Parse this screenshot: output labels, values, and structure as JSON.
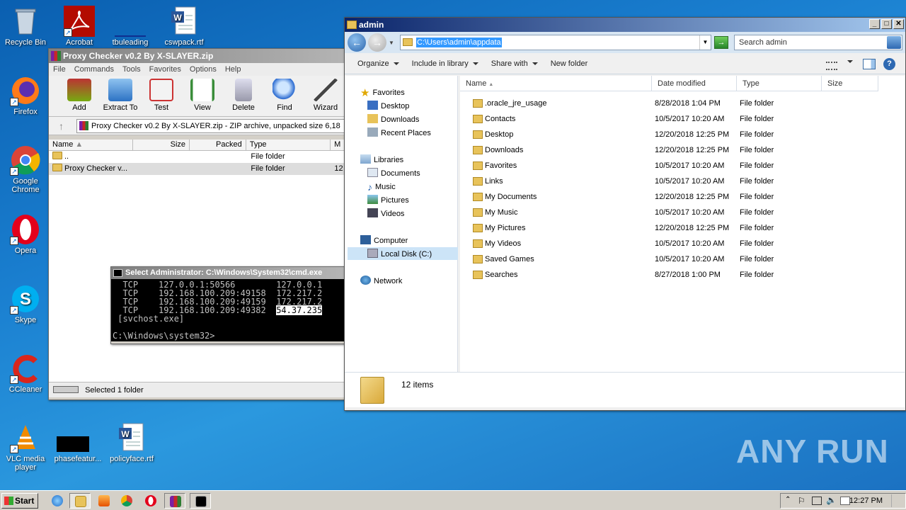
{
  "desktop": {
    "icons": [
      {
        "label": "Recycle Bin"
      },
      {
        "label": "Firefox"
      },
      {
        "label": "Google Chrome"
      },
      {
        "label": "Opera"
      },
      {
        "label": "Skype"
      },
      {
        "label": "CCleaner"
      },
      {
        "label": "VLC media player"
      },
      {
        "label": "Acrobat"
      },
      {
        "label": "tbuleading"
      },
      {
        "label": "cswpack.rtf"
      },
      {
        "label": "phasefeatur..."
      },
      {
        "label": "policyface.rtf"
      }
    ],
    "watermark": "ANY RUN"
  },
  "winrar": {
    "title": "Proxy Checker v0.2 By X-SLAYER.zip",
    "menu": [
      "File",
      "Commands",
      "Tools",
      "Favorites",
      "Options",
      "Help"
    ],
    "tools": [
      "Add",
      "Extract To",
      "Test",
      "View",
      "Delete",
      "Find",
      "Wizard"
    ],
    "path": "Proxy Checker v0.2 By X-SLAYER.zip - ZIP archive, unpacked size 6,18",
    "columns": [
      "Name",
      "Size",
      "Packed",
      "Type",
      "M"
    ],
    "rows": [
      {
        "name": "..",
        "type": "File folder",
        "m": ""
      },
      {
        "name": "Proxy Checker v...",
        "type": "File folder",
        "m": "12"
      }
    ],
    "status": "Selected 1 folder"
  },
  "cmd": {
    "title": "Select Administrator: C:\\Windows\\System32\\cmd.exe",
    "lines": [
      "  TCP    127.0.0.1:50566        127.0.0.1",
      "  TCP    192.168.100.209:49158  172.217.2",
      "  TCP    192.168.100.209:49159  172.217.2",
      "  TCP    192.168.100.209:49382  ",
      " [svchost.exe]",
      "",
      "C:\\Windows\\system32>"
    ],
    "highlight": "54.37.235"
  },
  "explorer": {
    "title": "admin",
    "address": "C:\\Users\\admin\\appdata",
    "search_placeholder": "Search admin",
    "commands": [
      "Organize",
      "Include in library",
      "Share with",
      "New folder"
    ],
    "nav": {
      "favorites": "Favorites",
      "fav_items": [
        "Desktop",
        "Downloads",
        "Recent Places"
      ],
      "libraries": "Libraries",
      "lib_items": [
        "Documents",
        "Music",
        "Pictures",
        "Videos"
      ],
      "computer": "Computer",
      "comp_items": [
        "Local Disk (C:)"
      ],
      "network": "Network"
    },
    "columns": [
      "Name",
      "Date modified",
      "Type",
      "Size"
    ],
    "files": [
      {
        "name": ".oracle_jre_usage",
        "date": "8/28/2018 1:04 PM",
        "type": "File folder"
      },
      {
        "name": "Contacts",
        "date": "10/5/2017 10:20 AM",
        "type": "File folder"
      },
      {
        "name": "Desktop",
        "date": "12/20/2018 12:25 PM",
        "type": "File folder"
      },
      {
        "name": "Downloads",
        "date": "12/20/2018 12:25 PM",
        "type": "File folder"
      },
      {
        "name": "Favorites",
        "date": "10/5/2017 10:20 AM",
        "type": "File folder"
      },
      {
        "name": "Links",
        "date": "10/5/2017 10:20 AM",
        "type": "File folder"
      },
      {
        "name": "My Documents",
        "date": "12/20/2018 12:25 PM",
        "type": "File folder"
      },
      {
        "name": "My Music",
        "date": "10/5/2017 10:20 AM",
        "type": "File folder"
      },
      {
        "name": "My Pictures",
        "date": "12/20/2018 12:25 PM",
        "type": "File folder"
      },
      {
        "name": "My Videos",
        "date": "10/5/2017 10:20 AM",
        "type": "File folder"
      },
      {
        "name": "Saved Games",
        "date": "10/5/2017 10:20 AM",
        "type": "File folder"
      },
      {
        "name": "Searches",
        "date": "8/27/2018 1:00 PM",
        "type": "File folder"
      }
    ],
    "item_count": "12 items"
  },
  "taskbar": {
    "start": "Start",
    "clock": "12:27 PM",
    "apps": [
      "internet-explorer-icon",
      "explorer-icon",
      "media-player-icon",
      "chrome-icon",
      "opera-icon",
      "winrar-icon",
      "cmd-icon"
    ]
  }
}
